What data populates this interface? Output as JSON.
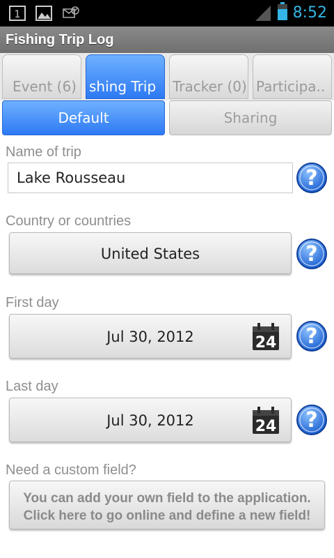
{
  "statusbar": {
    "time": "8:52",
    "icons": [
      "notification-1-icon",
      "image-icon",
      "no-sim-icon",
      "signal-icon",
      "battery-icon"
    ],
    "notification_count": "1"
  },
  "titlebar": {
    "title": "Fishing Trip Log"
  },
  "tabs": [
    {
      "label": "Event (6)",
      "active": false
    },
    {
      "label": "shing Trip",
      "active": true
    },
    {
      "label": "Tracker (0)",
      "active": false
    },
    {
      "label": "Participa..",
      "active": false
    }
  ],
  "subtabs": {
    "default": "Default",
    "sharing": "Sharing"
  },
  "form": {
    "name_label": "Name of trip",
    "name_value": "Lake Rousseau",
    "country_label": "Country or countries",
    "country_value": "United States",
    "first_day_label": "First day",
    "first_day_value": "Jul 30, 2012",
    "last_day_label": "Last day",
    "last_day_value": "Jul 30, 2012",
    "calendar_day": "24",
    "custom_label": "Need a custom field?",
    "custom_button_line1": "You can add your own field to the application.",
    "custom_button_line2": "Click here to go online and define a new field!"
  },
  "help_icon": {
    "glyph": "?"
  },
  "colors": {
    "accent": "#33b5e5",
    "active_tab": "#2d79f4",
    "help_blue": "#1a5fd1"
  }
}
